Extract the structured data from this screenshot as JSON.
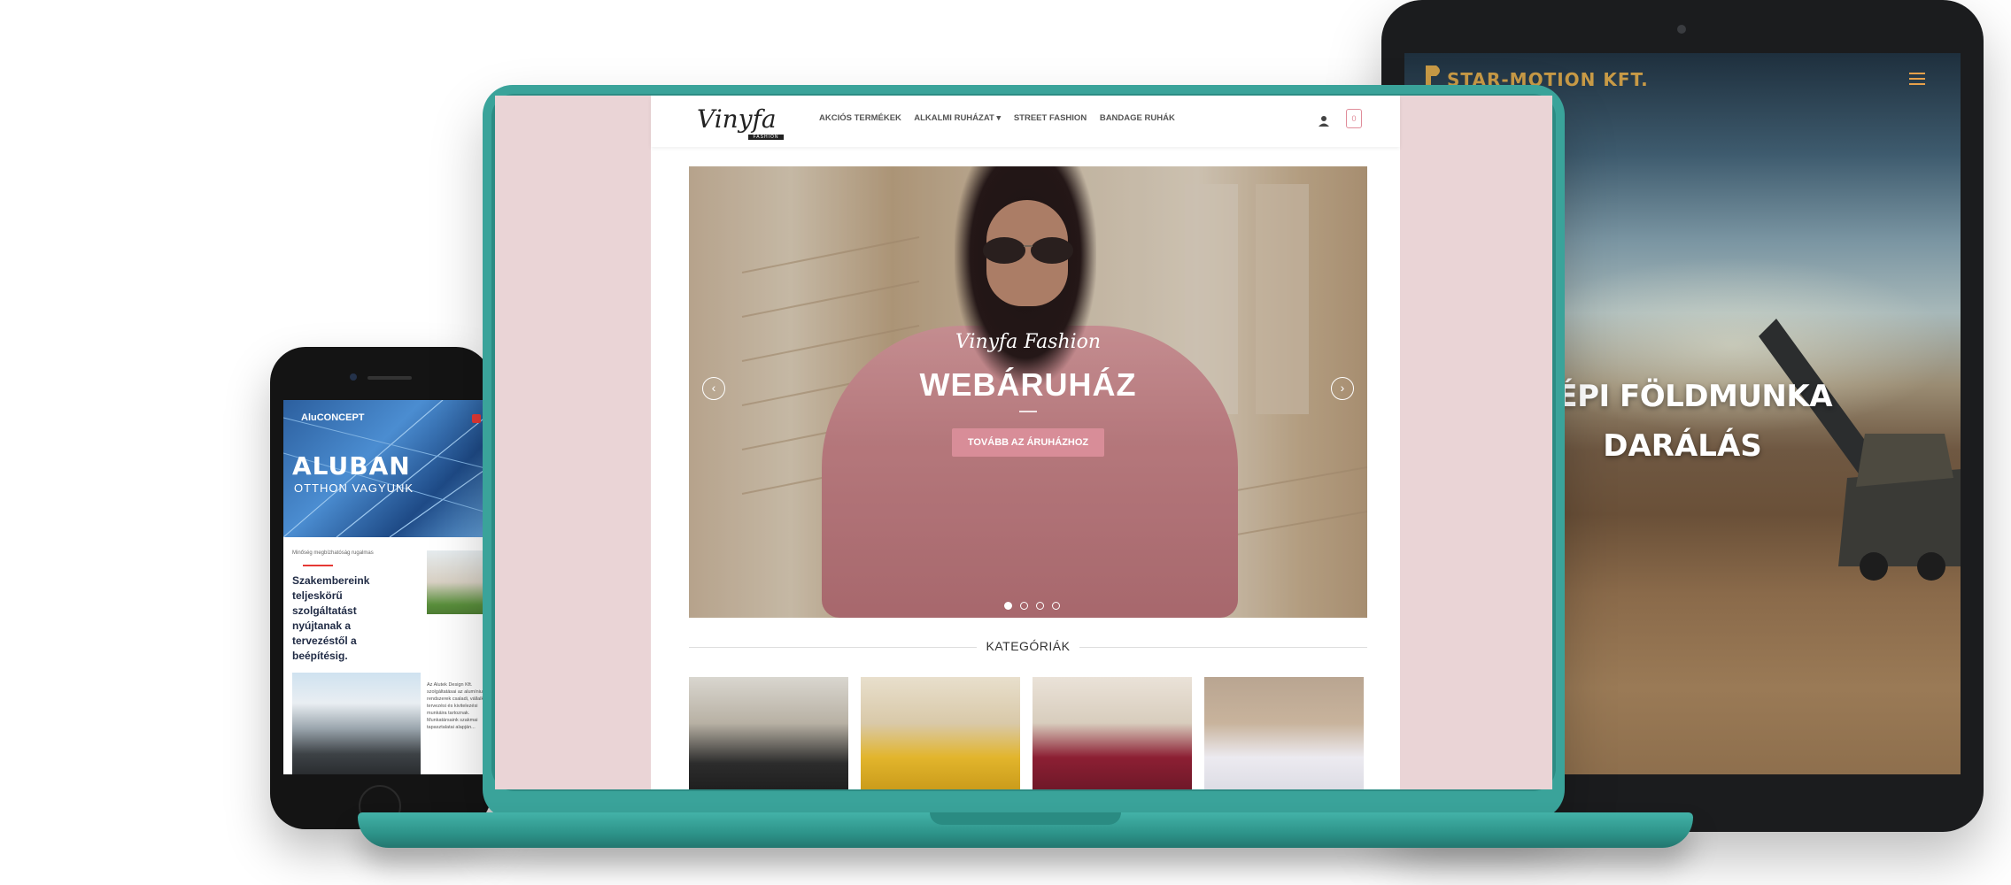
{
  "tablet": {
    "logo_text": "STAR-MOTION KFT.",
    "hero_line1": "GÉPI FÖLDMUNKA",
    "hero_line2": "DARÁLÁS",
    "menu_icon": "hamburger-icon"
  },
  "phone": {
    "brand": "AluCONCEPT",
    "hero_title": "ALUBAN",
    "hero_subtitle": "OTTHON VAGYUNK",
    "kicker": "Minőség megbízhatóság rugalmas",
    "lead": "Szakembereink teljeskörű szolgáltatást nyújtanak a tervezéstől a beépítésig.",
    "body_text": "Az Alutek Design Kft. szolgáltatásai az alumínium rendszerek csaladi, vállalkozói tervezési és kivitelezési munkáira tartoznak. Munkatársaink szakmai tapasztalatai alapján..."
  },
  "laptop_site": {
    "logo_script": "Vinyfa",
    "logo_tag": "FASHION",
    "nav": [
      {
        "label": "AKCIÓS TERMÉKEK"
      },
      {
        "label": "ALKALMI RUHÁZAT ▾"
      },
      {
        "label": "STREET FASHION"
      },
      {
        "label": "BANDAGE RUHÁK"
      }
    ],
    "cart_count": "0",
    "slide": {
      "subtitle": "Vinyfa Fashion",
      "title": "WEBÁRUHÁZ",
      "button": "TOVÁBB AZ ÁRUHÁZHOZ",
      "prev": "‹",
      "next": "›"
    },
    "categories_title": "KATEGÓRIÁK"
  },
  "colors": {
    "laptop_body": "#3aa39a",
    "site_bg": "#ead4d6",
    "accent_pink": "#d88d98",
    "tablet_orange": "#e8a14a"
  }
}
